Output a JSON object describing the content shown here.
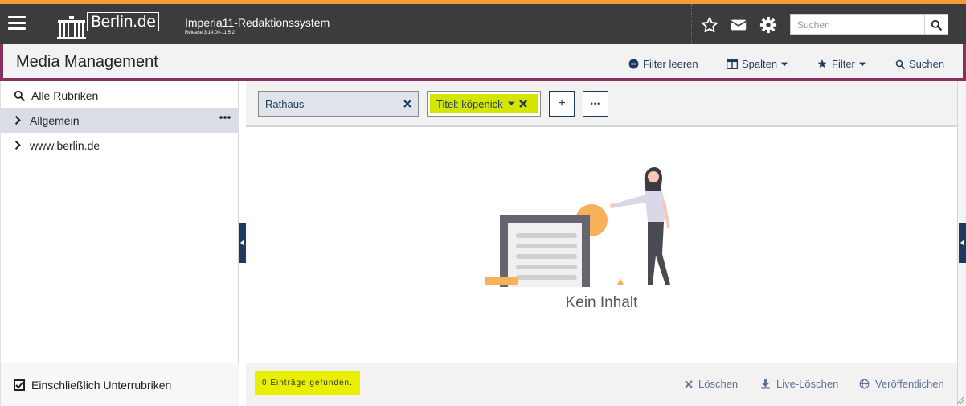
{
  "topbar": {
    "logo_text": "Berlin.de",
    "app_title": "Imperia11-Redaktionssystem",
    "release": "Release 3.14.00-11.5.2",
    "icons": [
      "menu-icon",
      "star-icon",
      "mail-icon",
      "gear-icon",
      "search-icon"
    ],
    "search_placeholder": "Suchen"
  },
  "subheader": {
    "title": "Media Management",
    "buttons": {
      "clear_filter": "Filter leeren",
      "columns": "Spalten",
      "filter": "Filter",
      "search": "Suchen"
    }
  },
  "sidebar": {
    "items": [
      {
        "label": "Alle Rubriken",
        "icon": "search-icon"
      },
      {
        "label": "Allgemein",
        "icon": "chevron-right-icon",
        "active": true
      },
      {
        "label": "www.berlin.de",
        "icon": "chevron-right-icon"
      }
    ],
    "include_subsections": "Einschließlich Unterrubriken",
    "include_checked": true
  },
  "filters": {
    "chip1": "Rathaus",
    "chip2": "Titel: köpenick",
    "add_label": "+",
    "more_label": "•••"
  },
  "main": {
    "empty_text": "Kein Inhalt"
  },
  "footer": {
    "count_text": "0 Einträge gefunden.",
    "delete": "Löschen",
    "live_delete": "Live-Löschen",
    "publish": "Veröffentlichen"
  },
  "colors": {
    "topbar_bg": "#3c3c3c",
    "accent_orange": "#f29b38",
    "brand_purple": "#8b2f5e",
    "navy": "#1f3a5f",
    "highlight_yellow": "#d4e600"
  }
}
